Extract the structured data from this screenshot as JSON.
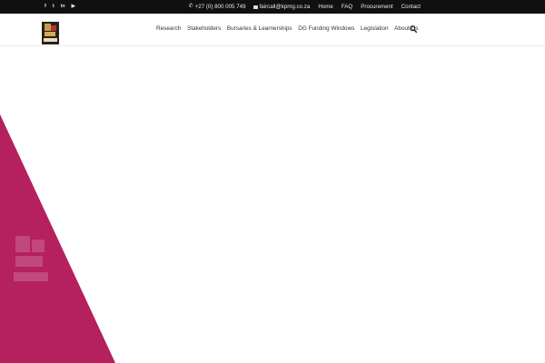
{
  "topbar": {
    "social": [
      {
        "icon": "facebook-icon",
        "glyph": "f"
      },
      {
        "icon": "twitter-icon",
        "glyph": "t"
      },
      {
        "icon": "linkedin-icon",
        "glyph": "in"
      },
      {
        "icon": "youtube-icon",
        "glyph": "▶"
      }
    ],
    "phone": "+27 (0) 800 005 749",
    "email": "faircall@kpmg.co.za",
    "links": [
      "Home",
      "FAQ",
      "Procurement",
      "Contact"
    ]
  },
  "header": {
    "nav": [
      "Research",
      "Stakeholders",
      "Bursaries & Learnerships",
      "DG Funding Windows",
      "Legislation",
      "About Us"
    ]
  },
  "colors": {
    "topbar_bg": "#101010",
    "accent_magenta": "#b5205f"
  }
}
